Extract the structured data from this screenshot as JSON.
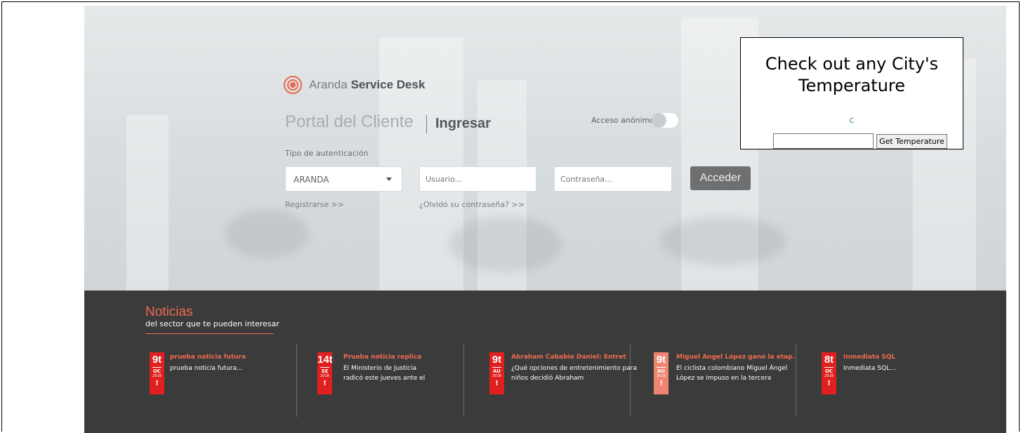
{
  "brand": {
    "name_light": "Aranda",
    "name_bold": "Service Desk",
    "accent": "#e9674e"
  },
  "login": {
    "portal_title": "Portal del Cliente",
    "ingresar": "Ingresar",
    "anon_label": "Acceso anónimo",
    "anon_enabled": false,
    "auth_label": "Tipo de autenticación",
    "auth_selected": "ARANDA",
    "user_placeholder": "Usuario...",
    "pass_placeholder": "Contraseña...",
    "submit_label": "Acceder",
    "register_link": "Registrarse >>",
    "forgot_link": "¿Olvidó su contraseña? >>"
  },
  "weather": {
    "title": "Check out any City's Temperature",
    "unit": "C",
    "input_value": "",
    "button_label": "Get Temperature"
  },
  "news": {
    "title": "Noticias",
    "subtitle": "del sector que te pueden interesar",
    "items": [
      {
        "day": "9t",
        "month": "OC",
        "year": "2018",
        "mark": "!",
        "headline": "prueba noticia futura",
        "body": "prueba noticia futura...",
        "badge_color": "#e01f1f"
      },
      {
        "day": "14t",
        "month": "SE",
        "year": "2018",
        "mark": "!",
        "headline": "Prueba noticia replica",
        "body": "El Ministerio de Justicia radicó este jueves ante el",
        "badge_color": "#e01f1f"
      },
      {
        "day": "9t",
        "month": "AU",
        "year": "2018",
        "mark": "!",
        "headline": "Abraham Cababie Daniel: Entret...",
        "body": "¿Qué opciones de entretenimiento para niños decidió Abraham",
        "badge_color": "#e01f1f"
      },
      {
        "day": "9t",
        "month": "AU",
        "year": "2018",
        "mark": "!",
        "headline": "Miguel Ángel López ganó la etap...",
        "body": "El ciclista colombiano Miguel Ángel López se impuso en la tercera",
        "badge_color": "#f08574"
      },
      {
        "day": "8t",
        "month": "OC",
        "year": "2018",
        "mark": "!",
        "headline": "Inmediata SQL",
        "body": "Inmediata SQL...",
        "badge_color": "#e01f1f"
      }
    ]
  }
}
